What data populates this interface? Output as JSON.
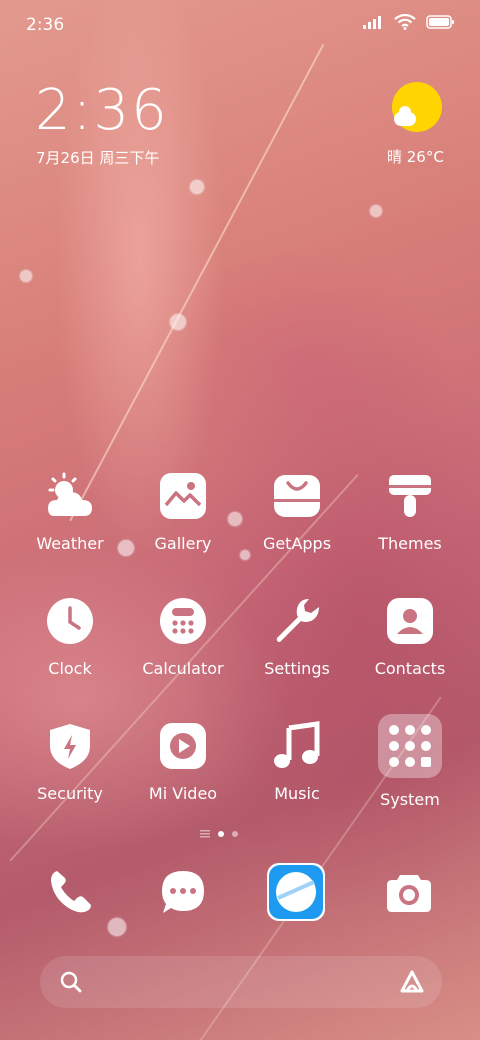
{
  "status_bar": {
    "time": "2:36",
    "icons": [
      "signal-icon",
      "wifi-icon",
      "battery-icon"
    ]
  },
  "clock_widget": {
    "time": "2:36",
    "date": "7月26日 周三下午"
  },
  "weather_widget": {
    "text": "晴 26°C",
    "icon": "sun-cloud-icon"
  },
  "apps": [
    {
      "label": "Weather",
      "icon": "weather-icon"
    },
    {
      "label": "Gallery",
      "icon": "gallery-icon"
    },
    {
      "label": "GetApps",
      "icon": "getapps-icon"
    },
    {
      "label": "Themes",
      "icon": "themes-icon"
    },
    {
      "label": "Clock",
      "icon": "clock-icon"
    },
    {
      "label": "Calculator",
      "icon": "calculator-icon"
    },
    {
      "label": "Settings",
      "icon": "settings-icon"
    },
    {
      "label": "Contacts",
      "icon": "contacts-icon"
    },
    {
      "label": "Security",
      "icon": "security-icon"
    },
    {
      "label": "Mi Video",
      "icon": "video-icon"
    },
    {
      "label": "Music",
      "icon": "music-icon"
    },
    {
      "label": "System",
      "icon": "folder-icon"
    }
  ],
  "page_indicator": {
    "pages": 2,
    "active": 1
  },
  "dock": [
    {
      "icon": "phone-icon"
    },
    {
      "icon": "messages-icon"
    },
    {
      "icon": "browser-icon"
    },
    {
      "icon": "camera-icon"
    }
  ],
  "search_bar": {
    "icon": "search-icon",
    "assistant_icon": "assistant-icon"
  },
  "colors": {
    "sun": "#ffd400",
    "browser_blue": "#1e9af0",
    "text": "#ffffff"
  }
}
